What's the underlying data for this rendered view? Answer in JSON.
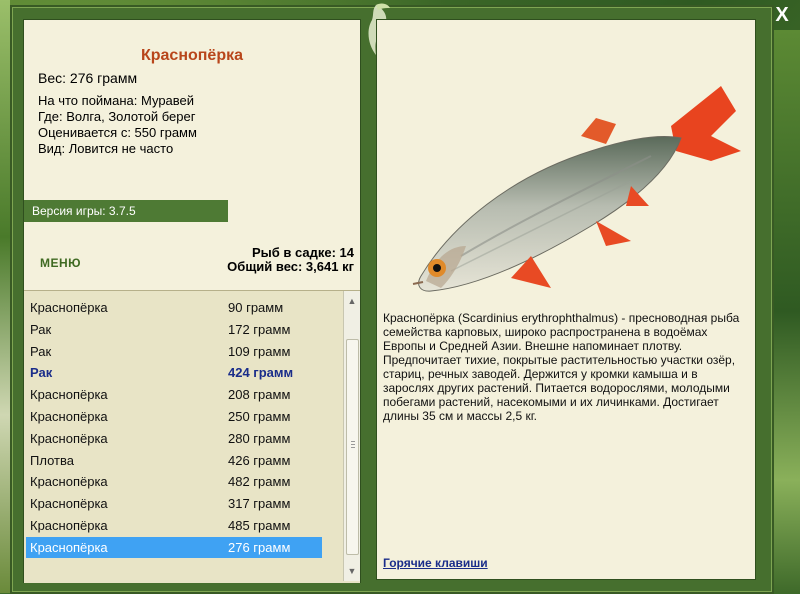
{
  "window": {
    "close_label": "X"
  },
  "fish": {
    "title": "Краснопёрка",
    "weight_line": "Вес: 276 грамм",
    "caught_with": "На что поймана: Муравей",
    "location": "Где: Волга, Золотой берег",
    "valued_from": "Оценивается с: 550 грамм",
    "type": "Вид: Ловится не часто"
  },
  "version": "Версия игры: 3.7.5",
  "menu_label": "МЕНЮ",
  "stats": {
    "fish_in_keepnet": "Рыб в садке: 14",
    "total_weight": "Общий вес: 3,641 кг"
  },
  "catch_list": [
    {
      "name": "Краснопёрка",
      "weight": "90 грамм",
      "style": "normal"
    },
    {
      "name": "Рак",
      "weight": "172 грамм",
      "style": "normal"
    },
    {
      "name": "Рак",
      "weight": "109 грамм",
      "style": "normal"
    },
    {
      "name": "Рак",
      "weight": "424 грамм",
      "style": "bold"
    },
    {
      "name": "Краснопёрка",
      "weight": "208 грамм",
      "style": "normal"
    },
    {
      "name": "Краснопёрка",
      "weight": "250 грамм",
      "style": "normal"
    },
    {
      "name": "Краснопёрка",
      "weight": "280 грамм",
      "style": "normal"
    },
    {
      "name": "Плотва",
      "weight": "426 грамм",
      "style": "normal"
    },
    {
      "name": "Краснопёрка",
      "weight": "482 грамм",
      "style": "normal"
    },
    {
      "name": "Краснопёрка",
      "weight": "317 грамм",
      "style": "normal"
    },
    {
      "name": "Краснопёрка",
      "weight": "485 грамм",
      "style": "normal"
    },
    {
      "name": "Краснопёрка",
      "weight": "276 грамм",
      "style": "selected"
    }
  ],
  "description": "Краснопёрка (Scardinius erythrophthalmus) - пресноводная рыба семейства карповых, широко распространена в водоёмах Европы и Средней Азии. Внешне напоминает плотву. Предпочитает тихие, покрытые растительностью участки озёр, стариц, речных заводей. Держится у кромки камыша и в зарослях других растений. Питается водорослями, молодыми побегами растений, насекомыми и их личинками. Достигает длины 35 см и массы 2,5 кг.",
  "hotkeys_label": "Горячие клавиши",
  "colors": {
    "title": "#b8461b",
    "panel": "#f4f1dc",
    "frame": "#466f2e",
    "selection": "#3fa2f3",
    "link": "#1a2d8a"
  }
}
